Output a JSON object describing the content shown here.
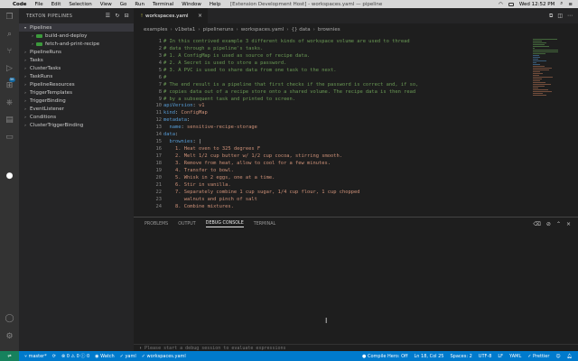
{
  "menubar": {
    "apple": "",
    "items": [
      "Code",
      "File",
      "Edit",
      "Selection",
      "View",
      "Go",
      "Run",
      "Terminal",
      "Window",
      "Help"
    ],
    "window_title": "[Extension Development Host] - workspaces.yaml — pipeline",
    "clock": "Wed 12:52 PM"
  },
  "sidebar": {
    "title": "TEKTON PIPELINES",
    "items": [
      {
        "label": "Pipelines",
        "indent": 0,
        "expanded": true,
        "selected": true
      },
      {
        "label": "build-and-deploy",
        "indent": 1,
        "expanded": false
      },
      {
        "label": "fetch-and-print-recipe",
        "indent": 1,
        "expanded": false
      },
      {
        "label": "PipelineRuns",
        "indent": 0,
        "expanded": false
      },
      {
        "label": "Tasks",
        "indent": 0,
        "expanded": false
      },
      {
        "label": "ClusterTasks",
        "indent": 0,
        "expanded": false
      },
      {
        "label": "TaskRuns",
        "indent": 0,
        "expanded": false
      },
      {
        "label": "PipelineResources",
        "indent": 0,
        "expanded": false
      },
      {
        "label": "TriggerTemplates",
        "indent": 0,
        "expanded": false
      },
      {
        "label": "TriggerBinding",
        "indent": 0,
        "expanded": false
      },
      {
        "label": "EventListener",
        "indent": 0,
        "expanded": false
      },
      {
        "label": "Conditions",
        "indent": 0,
        "expanded": false
      },
      {
        "label": "ClusterTriggerBinding",
        "indent": 0,
        "expanded": false
      }
    ],
    "badge": "5K"
  },
  "tab": {
    "label": "workspaces.yaml"
  },
  "breadcrumb": [
    "examples",
    "v1beta1",
    "pipelineruns",
    "workspaces.yaml",
    "{} data",
    "brownies"
  ],
  "editor": {
    "lines": [
      {
        "n": "",
        "t": "# In this contrived example 3 different kinds of workspace volume are used to thread",
        "c": "comment"
      },
      {
        "n": "",
        "t": "# data through a pipeline's tasks.",
        "c": "comment"
      },
      {
        "n": "",
        "t": "# 1. A ConfigMap is used as source of recipe data.",
        "c": "comment"
      },
      {
        "n": "",
        "t": "# 2. A Secret is used to store a password.",
        "c": "comment"
      },
      {
        "n": "",
        "t": "# 3. A PVC is used to share data from one task to the next.",
        "c": "comment"
      },
      {
        "n": "",
        "t": "#",
        "c": "comment"
      },
      {
        "n": "",
        "t": "# The end result is a pipeline that first checks if the password is correct and, if so,",
        "c": "comment"
      },
      {
        "n": "",
        "t": "# copies data out of a recipe store onto a shared volume. The recipe data is then read",
        "c": "comment"
      },
      {
        "n": "",
        "t": "# by a subsequent task and printed to screen.",
        "c": "comment"
      },
      {
        "n": "",
        "k": "apiVersion",
        "v": "v1",
        "c": "kv"
      },
      {
        "n": "",
        "k": "kind",
        "v": "ConfigMap",
        "c": "kv"
      },
      {
        "n": "",
        "k": "metadata",
        "v": "",
        "c": "kv"
      },
      {
        "n": "",
        "k": "  name",
        "v": "sensitive-recipe-storage",
        "c": "kv"
      },
      {
        "n": "",
        "k": "data",
        "v": "",
        "c": "kv"
      },
      {
        "n": "",
        "k": "  brownies",
        "v": "|",
        "c": "kv"
      },
      {
        "n": "",
        "t": "    1. Heat oven to 325 degrees F",
        "c": "str"
      },
      {
        "n": "",
        "t": "    2. Melt 1/2 cup butter w/ 1/2 cup cocoa, stirring smooth.",
        "c": "str"
      },
      {
        "n": "",
        "t": "    3. Remove from heat, allow to cool for a few minutes.",
        "c": "str"
      },
      {
        "n": "",
        "t": "    4. Transfer to bowl.",
        "c": "str"
      },
      {
        "n": "",
        "t": "    5. Whisk in 2 eggs, one at a time.",
        "c": "str"
      },
      {
        "n": "",
        "t": "    6. Stir in vanilla.",
        "c": "str"
      },
      {
        "n": "",
        "t": "    7. Separately combine 1 cup sugar, 1/4 cup flour, 1 cup chopped",
        "c": "str"
      },
      {
        "n": "",
        "t": "       walnuts and pinch of salt",
        "c": "str"
      },
      {
        "n": "",
        "t": "    8. Combine mixtures.",
        "c": "str"
      }
    ]
  },
  "panel": {
    "tabs": [
      "PROBLEMS",
      "OUTPUT",
      "DEBUG CONSOLE",
      "TERMINAL"
    ],
    "active": 2,
    "console_placeholder": "Please start a debug session to evaluate expressions"
  },
  "status": {
    "branch": "master*",
    "sync": "",
    "problems": "0",
    "warnings": "0",
    "info": "0",
    "watch": "Watch",
    "yaml_label": "yaml",
    "file": "workspaces.yaml",
    "compile_hero": "Compile Hero: Off",
    "position": "Ln 18, Col 25",
    "spaces": "Spaces: 2",
    "encoding": "UTF-8",
    "eol": "LF",
    "lang": "YAML",
    "prettier": "Prettier"
  }
}
